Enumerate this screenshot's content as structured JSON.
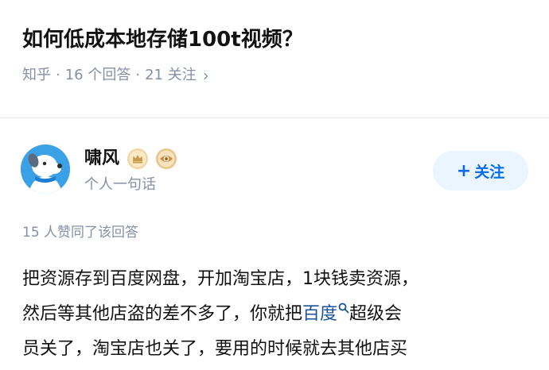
{
  "question": {
    "title": "如何低成本地存储100t视频？",
    "source": "知乎",
    "answers_count": "16 个回答",
    "followers_count": "21 关注",
    "sep": "·"
  },
  "author": {
    "name": "啸风",
    "bio": "个人一句话",
    "follow_label": "关注",
    "follow_plus": "+",
    "avatar_icon": "dog-avatar",
    "badges": [
      "crown-badge-icon",
      "eye-badge-icon"
    ]
  },
  "answer": {
    "votes_text": "15 人赞同了该回答",
    "line1": "把资源存到百度网盘，开加淘宝店，1块钱卖资源，",
    "line2_pre": "然后等其他店盗的差不多了，你就把",
    "line2_link": "百度",
    "line2_post": "超级会",
    "line3": "员关了，淘宝店也关了，要用的时候就去其他店买"
  },
  "colors": {
    "accent": "#056de8",
    "muted": "#8590a6",
    "link": "#175199",
    "follow_bg": "#ebf5ff",
    "avatar_bg": "#3ba1e6"
  }
}
